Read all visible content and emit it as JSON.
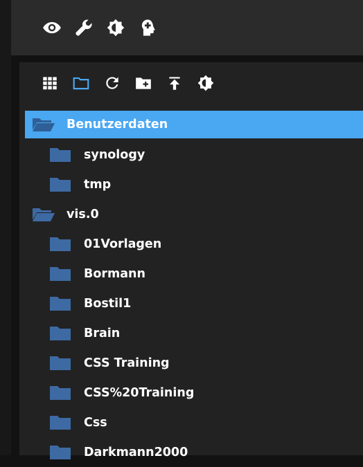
{
  "colors": {
    "accent": "#4aa7f1",
    "folder": "#3e6aa3",
    "folder_on_select": "#2f5f97",
    "panel_bg": "#222222",
    "topbar_bg": "#2b2b2b"
  },
  "topbar": {
    "icons": [
      "eye-icon",
      "wrench-icon",
      "brightness-icon",
      "head-silhouette-icon"
    ]
  },
  "toolbar": {
    "icons": [
      "grid-view-icon",
      "folder-outline-icon",
      "refresh-icon",
      "add-folder-icon",
      "upload-icon",
      "brightness-icon"
    ]
  },
  "tree": {
    "root": {
      "label": "Benutzerdaten",
      "selected": true
    },
    "root_children": [
      {
        "label": "synology"
      },
      {
        "label": "tmp"
      }
    ],
    "vis": {
      "label": "vis.0"
    },
    "vis_children": [
      {
        "label": "01Vorlagen"
      },
      {
        "label": "Bormann"
      },
      {
        "label": "Bostil1"
      },
      {
        "label": "Brain"
      },
      {
        "label": "CSS Training"
      },
      {
        "label": "CSS%20Training"
      },
      {
        "label": "Css"
      },
      {
        "label": "Darkmann2000"
      }
    ]
  }
}
